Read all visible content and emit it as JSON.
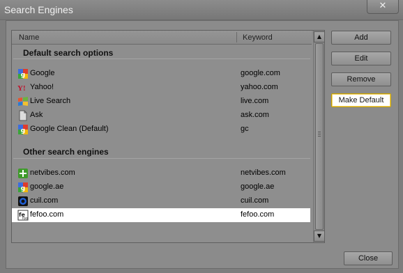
{
  "window": {
    "title": "Search Engines",
    "close_glyph": "✕"
  },
  "list": {
    "columns": {
      "name": "Name",
      "keyword": "Keyword"
    },
    "groups": [
      {
        "label": "Default search options",
        "items": [
          {
            "name": "Google",
            "keyword": "google.com",
            "icon": "google-icon"
          },
          {
            "name": "Yahoo!",
            "keyword": "yahoo.com",
            "icon": "yahoo-icon"
          },
          {
            "name": "Live Search",
            "keyword": "live.com",
            "icon": "windows-icon"
          },
          {
            "name": "Ask",
            "keyword": "ask.com",
            "icon": "document-icon"
          },
          {
            "name": "Google Clean (Default)",
            "keyword": "gc",
            "icon": "google-icon"
          }
        ]
      },
      {
        "label": "Other search engines",
        "items": [
          {
            "name": "netvibes.com",
            "keyword": "netvibes.com",
            "icon": "netvibes-icon"
          },
          {
            "name": "google.ae",
            "keyword": "google.ae",
            "icon": "google-icon"
          },
          {
            "name": "cuil.com",
            "keyword": "cuil.com",
            "icon": "cuil-icon"
          },
          {
            "name": "fefoo.com",
            "keyword": "fefoo.com",
            "icon": "fefoo-icon",
            "selected": true
          }
        ]
      }
    ]
  },
  "buttons": {
    "add": "Add",
    "edit": "Edit",
    "remove": "Remove",
    "make_default": "Make Default",
    "close": "Close"
  },
  "colors": {
    "selection": "#ffffff",
    "default_button_border": "#c5a000"
  }
}
